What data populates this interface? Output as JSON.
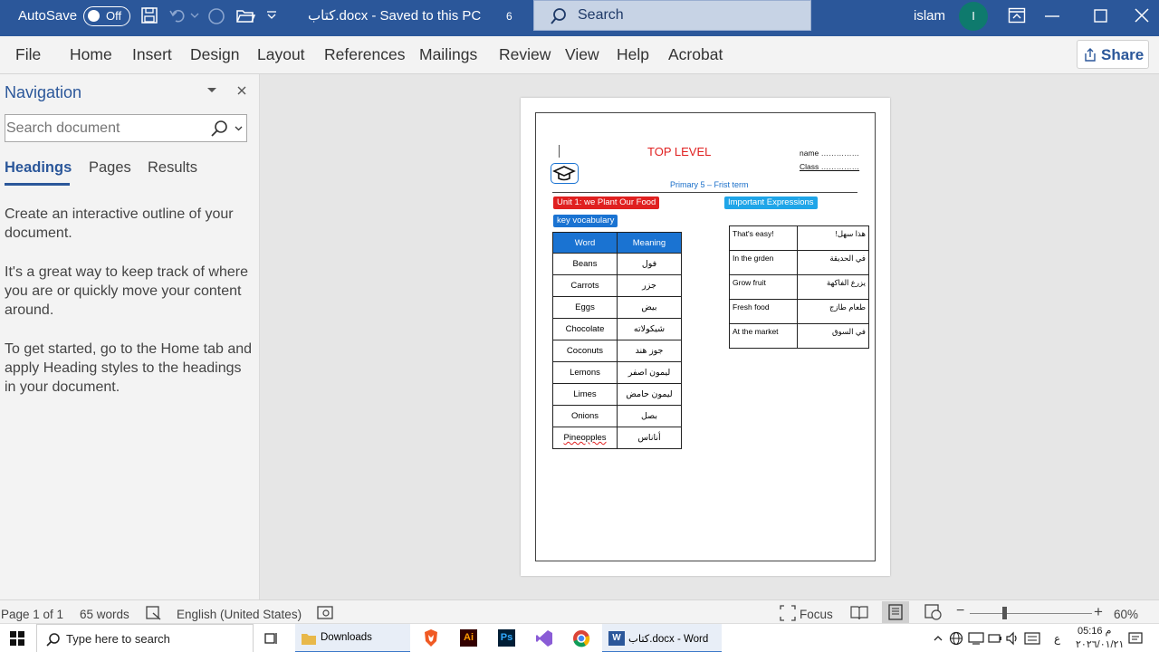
{
  "titlebar": {
    "autosave_label": "AutoSave",
    "autosave_state": "Off",
    "doc_title": "كتاب.docx  -  Saved to this PC",
    "doc_num": "6",
    "search_placeholder": "Search",
    "user_name": "islam",
    "avatar_initial": "I"
  },
  "ribbon": {
    "tabs": [
      "File",
      "Home",
      "Insert",
      "Design",
      "Layout",
      "References",
      "Mailings",
      "Review",
      "View",
      "Help",
      "Acrobat"
    ],
    "share_label": "Share"
  },
  "nav": {
    "title": "Navigation",
    "search_placeholder": "Search document",
    "tabs": [
      "Headings",
      "Pages",
      "Results"
    ],
    "p1": "Create an interactive outline of your document.",
    "p2": "It's a great way to keep track of where you are or quickly move your content around.",
    "p3": "To get started, go to the Home tab and apply Heading styles to the headings in your document."
  },
  "doc": {
    "title": "TOP LEVEL",
    "name_field": "name ……………",
    "class_field": "Class ……………",
    "subtitle": "Primary 5 – Frist term",
    "unit_label": "Unit 1: we Plant Our Food",
    "expressions_label": "Important Expressions",
    "vocab_label": "key vocabulary",
    "vocab_headers": [
      "Word",
      "Meaning"
    ],
    "vocab": [
      [
        "Beans",
        "فول"
      ],
      [
        "Carrots",
        "جزر"
      ],
      [
        "Eggs",
        "بيض"
      ],
      [
        "Chocolate",
        "شيكولاته"
      ],
      [
        "Coconuts",
        "جوز هند"
      ],
      [
        "Lemons",
        "ليمون اصفر"
      ],
      [
        "Limes",
        "ليمون حامض"
      ],
      [
        "Onions",
        "بصل"
      ],
      [
        "Pineopples",
        "أناناس"
      ]
    ],
    "expressions": [
      [
        "That's easy!",
        "هذا سهل!"
      ],
      [
        "In the grden",
        "في الحديقة"
      ],
      [
        "Grow fruit",
        "يزرع الفاكهة"
      ],
      [
        "Fresh food",
        "طعام طازج"
      ],
      [
        "At the market",
        "في السوق"
      ]
    ]
  },
  "status": {
    "page": "Page 1 of 1",
    "words": "65 words",
    "language": "English (United States)",
    "focus": "Focus",
    "zoom": "60%",
    "zoom_level": 0.6
  },
  "taskbar": {
    "search_placeholder": "Type here to search",
    "downloads": "Downloads",
    "word_window": "كتاب.docx - Word",
    "time": "05:16 م",
    "date": "٢٠٢٦/٠١/٢١",
    "lang_indicator": "ع"
  },
  "colors": {
    "word_blue": "#2b579a",
    "title_red": "#e02020",
    "label_blue": "#1a73d2"
  }
}
